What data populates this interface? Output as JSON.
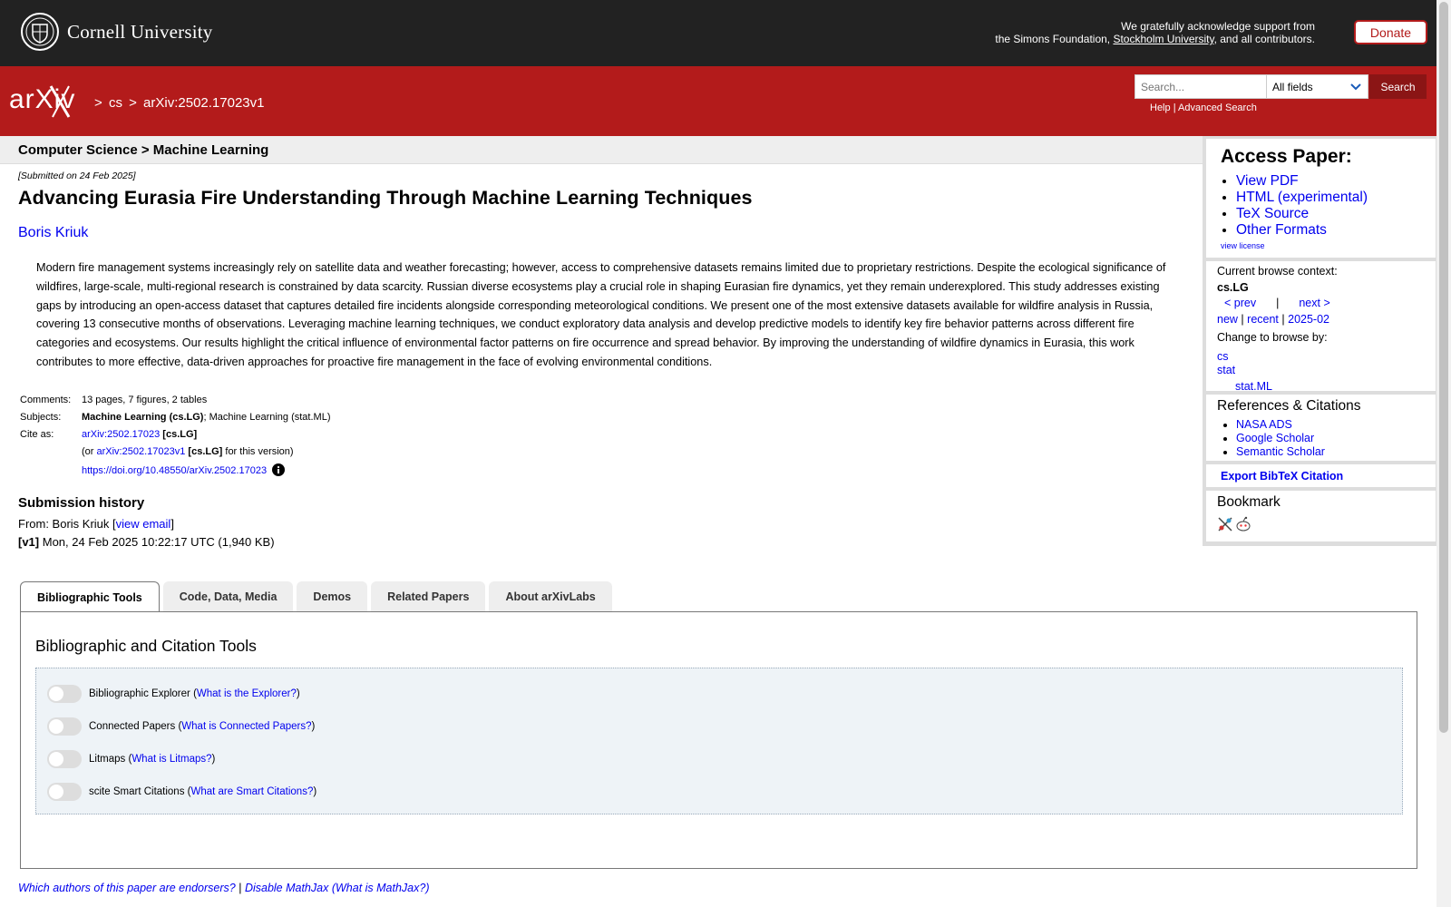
{
  "header": {
    "university": "Cornell University",
    "support_line1": "We gratefully acknowledge support from",
    "support_line2_pre": "the Simons Foundation, ",
    "support_link": "Stockholm University",
    "support_line2_post": ", and all contributors.",
    "donate_label": "Donate",
    "logo_text": "arXiv",
    "breadcrumb": [
      ">",
      "cs",
      ">",
      "arXiv:2502.17023v1"
    ],
    "search_placeholder": "Search...",
    "search_field": "All fields",
    "search_button": "Search",
    "help_label": "Help",
    "help_sep": "|",
    "advanced_label": "Advanced Search"
  },
  "paper": {
    "subject_header": "Computer Science > Machine Learning",
    "submitted": "[Submitted on 24 Feb 2025]",
    "title": "Advancing Eurasia Fire Understanding Through Machine Learning Techniques",
    "author": "Boris Kriuk",
    "abstract": "Modern fire management systems increasingly rely on satellite data and weather forecasting; however, access to comprehensive datasets remains limited due to proprietary restrictions. Despite the ecological significance of wildfires, large-scale, multi-regional research is constrained by data scarcity. Russian diverse ecosystems play a crucial role in shaping Eurasian fire dynamics, yet they remain underexplored. This study addresses existing gaps by introducing an open-access dataset that captures detailed fire incidents alongside corresponding meteorological conditions. We present one of the most extensive datasets available for wildfire analysis in Russia, covering 13 consecutive months of observations. Leveraging machine learning techniques, we conduct exploratory data analysis and develop predictive models to identify key fire behavior patterns across different fire categories and ecosystems. Our results highlight the critical influence of environmental factor patterns on fire occurrence and spread behavior. By improving the understanding of wildfire dynamics in Eurasia, this work contributes to more effective, data-driven approaches for proactive fire management in the face of evolving environmental conditions.",
    "comments_label": "Comments:",
    "comments": "13 pages, 7 figures, 2 tables",
    "subjects_label": "Subjects:",
    "subject_primary": "Machine Learning (cs.LG)",
    "subject_rest": "; Machine Learning (stat.ML)",
    "cite_label": "Cite as:",
    "cite_id": "arXiv:2502.17023",
    "cite_cat": "[cs.LG]",
    "cite_or": "(or ",
    "cite_version": "arXiv:2502.17023v1",
    "cite_version_cat": "[cs.LG]",
    "cite_version_post": " for this version)",
    "doi": "https://doi.org/10.48550/arXiv.2502.17023"
  },
  "history": {
    "title": "Submission history",
    "from_pre": "From: Boris Kriuk [",
    "view_email": "view email",
    "from_post": "]",
    "v1_label": "[v1]",
    "v1_text": " Mon, 24 Feb 2025 10:22:17 UTC (1,940 KB)"
  },
  "sidebar": {
    "access_title": "Access Paper:",
    "access_links": [
      "View PDF",
      "HTML (experimental)",
      "TeX Source",
      "Other Formats"
    ],
    "view_license": "view license",
    "browse_context_label": "Current browse context:",
    "browse_context": "cs.LG",
    "prev": "< prev",
    "nav_sep": "|",
    "next": "next >",
    "new": "new",
    "recent": "recent",
    "month": "2025-02",
    "change_label": "Change to browse by:",
    "browse_cs": "cs",
    "browse_stat": "stat",
    "browse_statml": "stat.ML",
    "refs_title": "References & Citations",
    "refs_links": [
      "NASA ADS",
      "Google Scholar",
      "Semantic Scholar"
    ],
    "bibtex": "Export BibTeX Citation",
    "bookmark_title": "Bookmark"
  },
  "tabs": {
    "items": [
      "Bibliographic Tools",
      "Code, Data, Media",
      "Demos",
      "Related Papers",
      "About arXivLabs"
    ],
    "active": 0,
    "panel_title": "Bibliographic and Citation Tools",
    "tools": [
      {
        "name": "Bibliographic Explorer",
        "link": "What is the Explorer?"
      },
      {
        "name": "Connected Papers",
        "link": "What is Connected Papers?"
      },
      {
        "name": "Litmaps",
        "link": "What is Litmaps?"
      },
      {
        "name": "scite Smart Citations",
        "link": "What are Smart Citations?"
      }
    ]
  },
  "footer": {
    "endorsers": "Which authors of this paper are endorsers?",
    "sep": "|",
    "disable_mathjax": "Disable MathJax",
    "what_mathjax": "(What is MathJax?)"
  },
  "colors": {
    "arxiv_red": "#b31b1b",
    "top_bar": "#222222",
    "link": "#0000ee"
  }
}
